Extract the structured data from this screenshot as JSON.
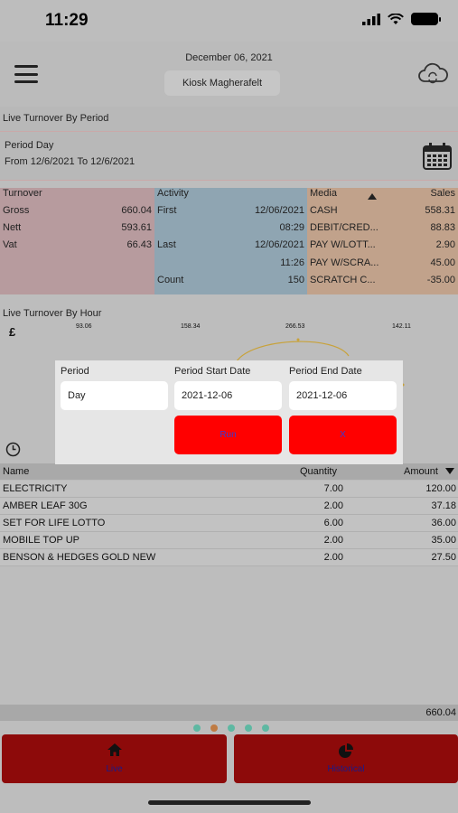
{
  "status_bar": {
    "time": "11:29"
  },
  "header": {
    "date": "December 06, 2021",
    "store": "Kiosk Magherafelt"
  },
  "section_period": {
    "title": "Live Turnover By Period"
  },
  "period": {
    "label": "Period Day",
    "range": "From 12/6/2021 To 12/6/2021"
  },
  "turnover": {
    "title": "Turnover",
    "rows": [
      {
        "label": "Gross",
        "value": "660.04"
      },
      {
        "label": "Nett",
        "value": "593.61"
      },
      {
        "label": "Vat",
        "value": "66.43"
      }
    ]
  },
  "activity": {
    "title": "Activity",
    "first_label": "First",
    "first_date": "12/06/2021",
    "first_time": "08:29",
    "last_label": "Last",
    "last_date": "12/06/2021",
    "last_time": "11:26",
    "count_label": "Count",
    "count": "150"
  },
  "media": {
    "title": "Media",
    "sales_title": "Sales",
    "rows": [
      {
        "label": "CASH",
        "value": "558.31"
      },
      {
        "label": "DEBIT/CRED...",
        "value": "88.83"
      },
      {
        "label": "PAY W/LOTT...",
        "value": "2.90"
      },
      {
        "label": "PAY W/SCRA...",
        "value": "45.00"
      },
      {
        "label": "SCRATCH C...",
        "value": "-35.00"
      }
    ]
  },
  "section_hour": {
    "title": "Live Turnover By Hour",
    "currency": "£"
  },
  "chart_data": {
    "type": "line",
    "visible_labels": [
      "93.06",
      "158.34",
      "266.53",
      "142.11"
    ]
  },
  "dialog": {
    "period_label": "Period",
    "start_label": "Period Start Date",
    "end_label": "Period End Date",
    "period_value": "Day",
    "start_value": "2021-12-06",
    "end_value": "2021-12-06",
    "run_label": "Run",
    "close_label": "X"
  },
  "table": {
    "headers": {
      "name": "Name",
      "quantity": "Quantity",
      "amount": "Amount"
    },
    "rows": [
      {
        "name": "ELECTRICITY",
        "quantity": "7.00",
        "amount": "120.00"
      },
      {
        "name": "AMBER LEAF 30G",
        "quantity": "2.00",
        "amount": "37.18"
      },
      {
        "name": "SET FOR LIFE LOTTO",
        "quantity": "6.00",
        "amount": "36.00"
      },
      {
        "name": "MOBILE TOP UP",
        "quantity": "2.00",
        "amount": "35.00"
      },
      {
        "name": "BENSON & HEDGES GOLD NEW",
        "quantity": "2.00",
        "amount": "27.50"
      }
    ],
    "total": "660.04"
  },
  "bottom_nav": {
    "left_label": "Live",
    "right_label": "Historical"
  },
  "colors": {
    "accent_red": "#ff0000",
    "dark_red": "#8d0a0a",
    "dot_teal": "#3fb79a",
    "dot_active": "#c0651b"
  }
}
